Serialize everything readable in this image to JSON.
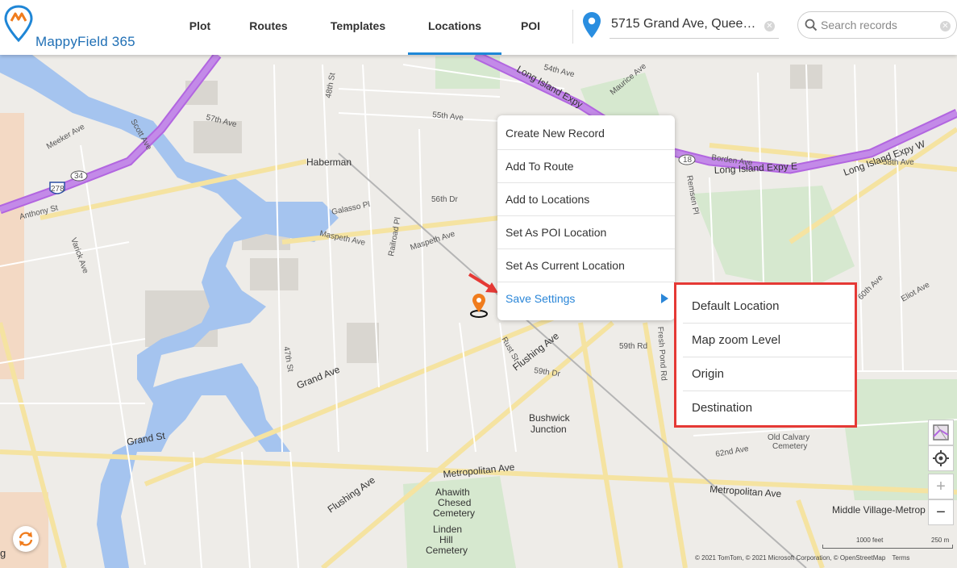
{
  "app": {
    "name": "MappyField 365"
  },
  "nav": [
    {
      "label": "Plot"
    },
    {
      "label": "Routes"
    },
    {
      "label": "Templates"
    },
    {
      "label": "Locations",
      "active": true
    },
    {
      "label": "POI"
    }
  ],
  "address": {
    "value": "5715 Grand Ave, Queens, NY"
  },
  "search": {
    "placeholder": "Search records"
  },
  "context_menu": {
    "items": [
      {
        "label": "Create New Record"
      },
      {
        "label": "Add To Route"
      },
      {
        "label": "Add to Locations"
      },
      {
        "label": "Set As POI Location"
      },
      {
        "label": "Set As Current Location"
      },
      {
        "label": "Save Settings",
        "has_submenu": true
      }
    ]
  },
  "submenu": {
    "items": [
      {
        "label": "Default Location"
      },
      {
        "label": "Map zoom Level"
      },
      {
        "label": "Origin"
      },
      {
        "label": "Destination"
      }
    ]
  },
  "map": {
    "place_labels": {
      "haberman": "Haberman",
      "bushwick_junction_1": "Bushwick",
      "bushwick_junction_2": "Junction",
      "old_calvary_1": "Old Calvary",
      "old_calvary_2": "Cemetery",
      "ahawith_1": "Ahawith",
      "ahawith_2": "Chesed",
      "ahawith_3": "Cemetery",
      "linden_1": "Linden",
      "linden_2": "Hill",
      "linden_3": "Cemetery",
      "middle_village": "Middle Village-Metrop",
      "grand_ave": "Grand Ave",
      "grand_st": "Grand St",
      "metropolitan_ave": "Metropolitan Ave",
      "flushing_ave": "Flushing Ave",
      "maspeth_ave": "Maspeth Ave",
      "lie_1": "Long Island Expy",
      "lie_2": "Long Island Expy E",
      "lie_3": "Long Island Expy W",
      "borden_ave": "Borden Ave",
      "rust_st": "Rust St",
      "fresh_pond_rd": "Fresh Pond Rd",
      "eliot_ave": "Eliot Ave",
      "anthony_st": "Anthony St",
      "meeker_ave": "Meeker Ave",
      "varick_ave": "Varick Ave",
      "scott_ave": "Scott Ave",
      "st_47": "47th St",
      "st_48": "48th St",
      "rd_59": "59th Rd",
      "dr_59": "59th Dr",
      "ave_62": "62nd Ave",
      "ave_60": "60th Ave",
      "ave_57": "57th Ave",
      "ave_55": "55th Ave",
      "ave_54": "54th Ave",
      "galasso": "Galasso Pl",
      "railroad": "Railroad Pl",
      "maurice": "Maurice Ave",
      "remsen": "Remsen Pl",
      "dr_56": "56th Dr",
      "ave_58": "58th Ave"
    },
    "shields": [
      "278",
      "34",
      "18"
    ],
    "scale": {
      "feet": "1000 feet",
      "meters": "250 m"
    },
    "attribution": "© 2021 TomTom, © 2021 Microsoft Corporation, © OpenStreetMap",
    "terms": "Terms",
    "corner_text": "g"
  },
  "controls": {
    "zoom_in": "+",
    "zoom_out": "−"
  },
  "colors": {
    "accent": "#1e88d8",
    "highway": "#c38ae8",
    "water": "#a5c4ef",
    "highlight": "#e53935",
    "marker": "#f07c1d"
  }
}
